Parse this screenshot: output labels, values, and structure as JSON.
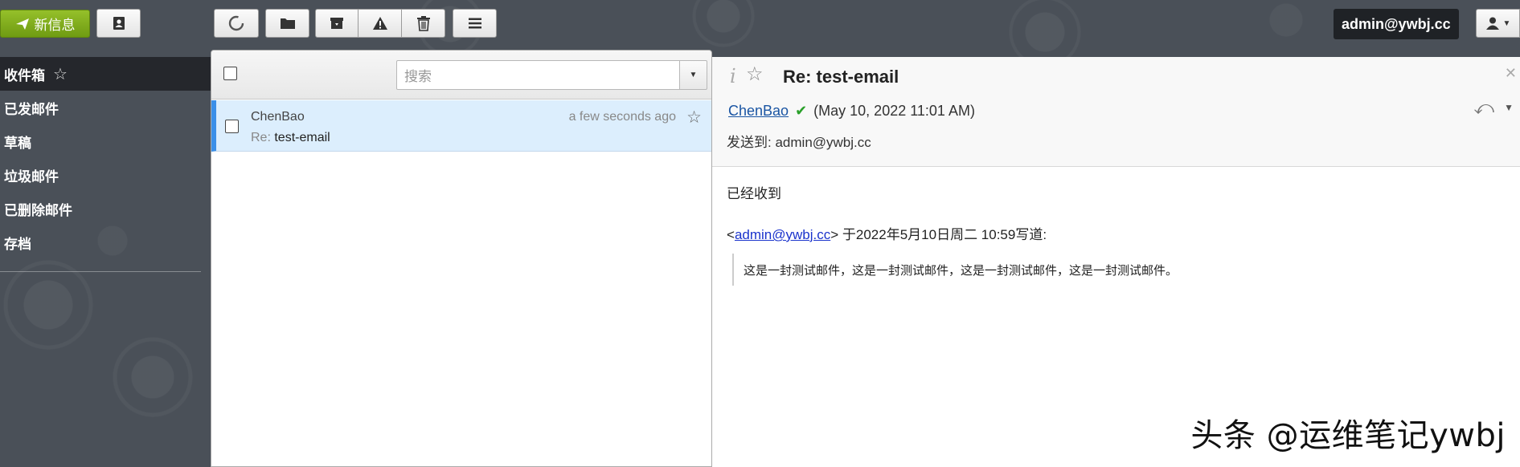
{
  "toolbar": {
    "compose_label": "新信息"
  },
  "account": {
    "email": "admin@ywbj.cc"
  },
  "folders": [
    {
      "label": "收件箱",
      "active": true
    },
    {
      "label": "已发邮件"
    },
    {
      "label": "草稿"
    },
    {
      "label": "垃圾邮件"
    },
    {
      "label": "已删除邮件"
    },
    {
      "label": "存档"
    }
  ],
  "search": {
    "placeholder": "搜索"
  },
  "message_list": [
    {
      "from": "ChenBao",
      "subject_prefix": "Re:",
      "subject": "test-email",
      "date": "a few seconds ago"
    }
  ],
  "reading": {
    "subject": "Re: test-email",
    "sender": "ChenBao",
    "date": "(May 10, 2022 11:01 AM)",
    "to_label": "发送到:",
    "to": "admin@ywbj.cc",
    "body_line": "已经收到",
    "quote_email": "admin@ywbj.cc",
    "quote_intro": "于2022年5月10日周二 10:59写道:",
    "quote_text": "这是一封测试邮件，这是一封测试邮件，这是一封测试邮件，这是一封测试邮件。"
  },
  "watermark": "头条 @运维笔记ywbj"
}
